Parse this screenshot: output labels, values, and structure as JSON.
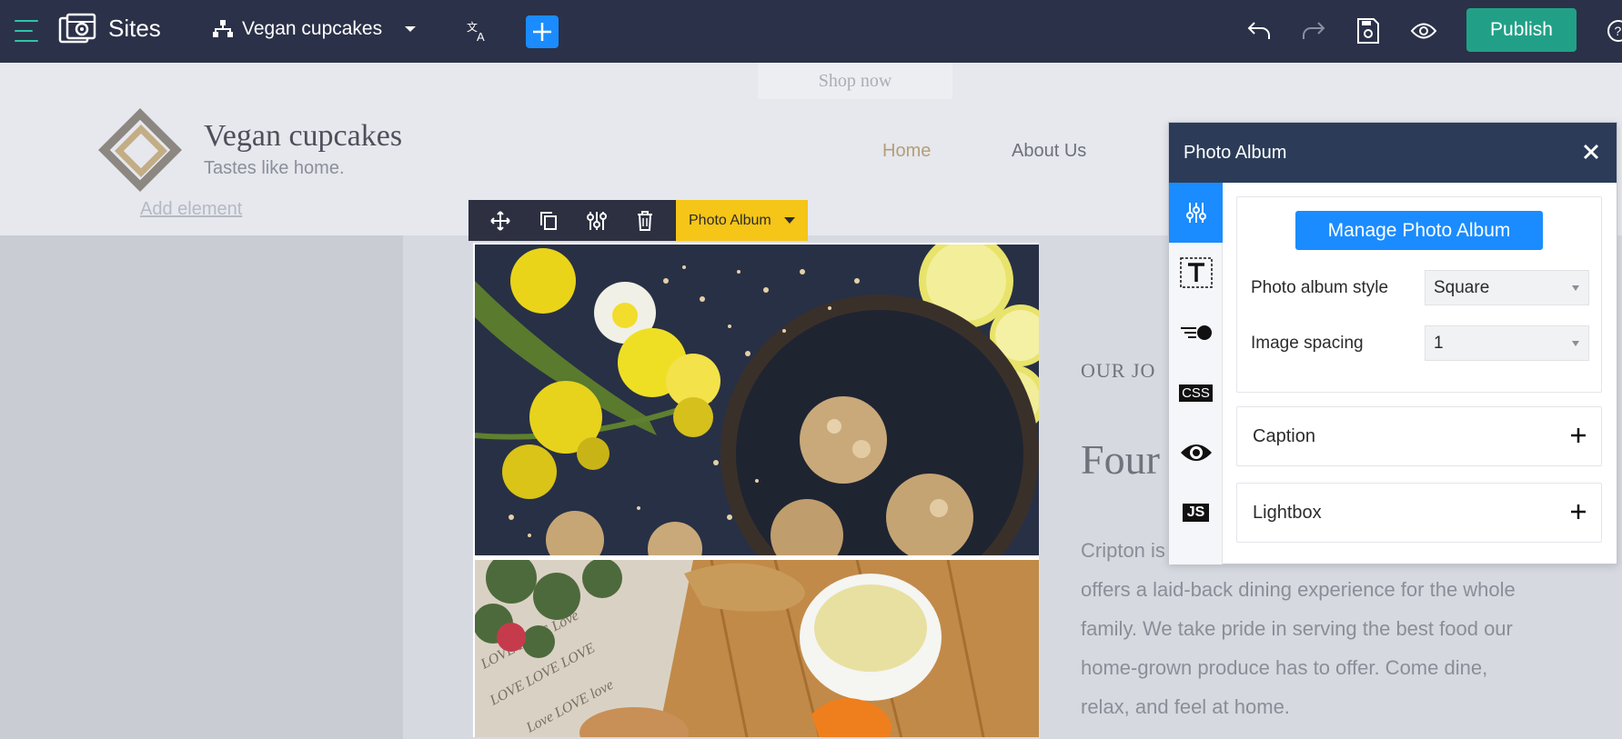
{
  "topbar": {
    "app_name": "Sites",
    "site_name": "Vegan cupcakes",
    "publish_label": "Publish"
  },
  "website": {
    "hero_button": "Shop now",
    "title": "Vegan cupcakes",
    "tagline": "Tastes like home.",
    "nav": [
      "Home",
      "About Us"
    ],
    "add_element": "Add element",
    "section_kicker": "OUR JO",
    "section_heading": "Four",
    "body_lines": [
      "Cripton is",
      "offers a laid-back dining experience for the whole",
      "family. We take pride in serving the best food our",
      "home-grown produce has to offer. Come dine,",
      "relax, and feel at home."
    ]
  },
  "element_toolbar": {
    "element_type": "Photo Album"
  },
  "panel": {
    "title": "Photo Album",
    "manage_button": "Manage Photo Album",
    "style_label": "Photo album style",
    "style_value": "Square",
    "spacing_label": "Image spacing",
    "spacing_value": "1",
    "caption_label": "Caption",
    "lightbox_label": "Lightbox",
    "css_tab": "CSS",
    "js_tab": "JS"
  },
  "colors": {
    "topbar": "#2b3148",
    "accent_blue": "#1a8cff",
    "publish_green": "#22a087",
    "element_label_yellow": "#f5c518",
    "panel_header": "#2c3c58"
  }
}
